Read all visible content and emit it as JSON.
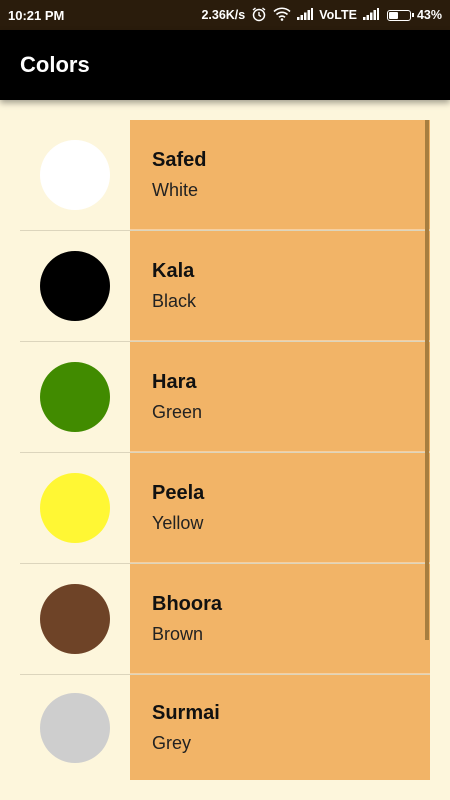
{
  "status_bar": {
    "time": "10:21 PM",
    "network_speed": "2.36K/s",
    "carrier": "VoLTE",
    "battery": "43%",
    "battery_level": 0.43,
    "icons": [
      "alarm-icon",
      "wifi-icon",
      "signal-icon",
      "signal-icon",
      "battery-icon"
    ]
  },
  "app_bar": {
    "title": "Colors"
  },
  "colors": [
    {
      "name": "Safed",
      "meaning": "White",
      "hex": "#ffffff"
    },
    {
      "name": "Kala",
      "meaning": "Black",
      "hex": "#000000"
    },
    {
      "name": "Hara",
      "meaning": "Green",
      "hex": "#418b00"
    },
    {
      "name": "Peela",
      "meaning": "Yellow",
      "hex": "#fff734"
    },
    {
      "name": "Bhoora",
      "meaning": "Brown",
      "hex": "#6e4327"
    },
    {
      "name": "Surmai",
      "meaning": "Grey",
      "hex": "#cecece"
    }
  ],
  "theme": {
    "background": "#fdf6dc",
    "item_background": "#f2b467",
    "app_bar": "#000000"
  }
}
